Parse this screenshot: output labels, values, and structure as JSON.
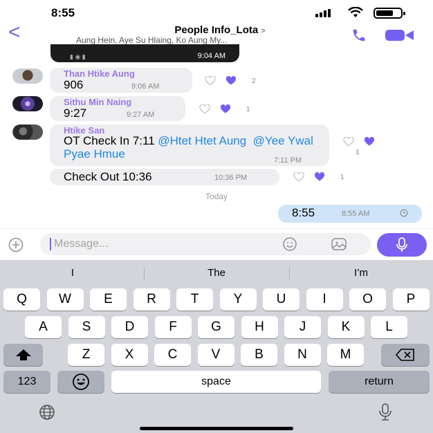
{
  "status": {
    "time": "8:55"
  },
  "header": {
    "back": "<",
    "title": "People Info_Lota",
    "title_chevron": ">",
    "subtitle": "Aung Hein, Aye Su Hlaing, Ko Aung My...",
    "call_icon": "phone-icon",
    "video_icon": "video-icon"
  },
  "messages": {
    "image_time": "9:04 AM",
    "m1": {
      "sender": "Than Htike Aung",
      "text": "906",
      "time": "9:06 AM",
      "likes": "2"
    },
    "m2": {
      "sender": "Sithu Min Naing",
      "text": "9:27",
      "time": "9:27 AM",
      "likes": "1"
    },
    "m3": {
      "sender": "Htike San",
      "text_prefix": "OT Check In 7:11 ",
      "mention1": "@Htet Htet Aung",
      "mention2": "@Yee Ywal Pyae Hmue",
      "time": "7:11 PM",
      "likes": "1"
    },
    "m4": {
      "text": "Check Out 10:36",
      "time": "10:36 PM",
      "likes": "1"
    },
    "divider": "Today",
    "outgoing": {
      "text": "8:55",
      "time": "8:55 AM"
    }
  },
  "input": {
    "placeholder": "Message..."
  },
  "keyboard": {
    "suggestions": [
      "I",
      "The",
      "I’m"
    ],
    "row1": [
      "Q",
      "W",
      "E",
      "R",
      "T",
      "Y",
      "U",
      "I",
      "O",
      "P"
    ],
    "row2": [
      "A",
      "S",
      "D",
      "F",
      "G",
      "H",
      "J",
      "K",
      "L"
    ],
    "row3": [
      "Z",
      "X",
      "C",
      "V",
      "B",
      "N",
      "M"
    ],
    "numbers": "123",
    "space": "space",
    "return": "return"
  },
  "colors": {
    "accent": "#7360f2",
    "incoming": "#eeeef1",
    "outgoing": "#cfe4f9",
    "mention": "#1f87e8",
    "sender": "#9b78e6"
  }
}
